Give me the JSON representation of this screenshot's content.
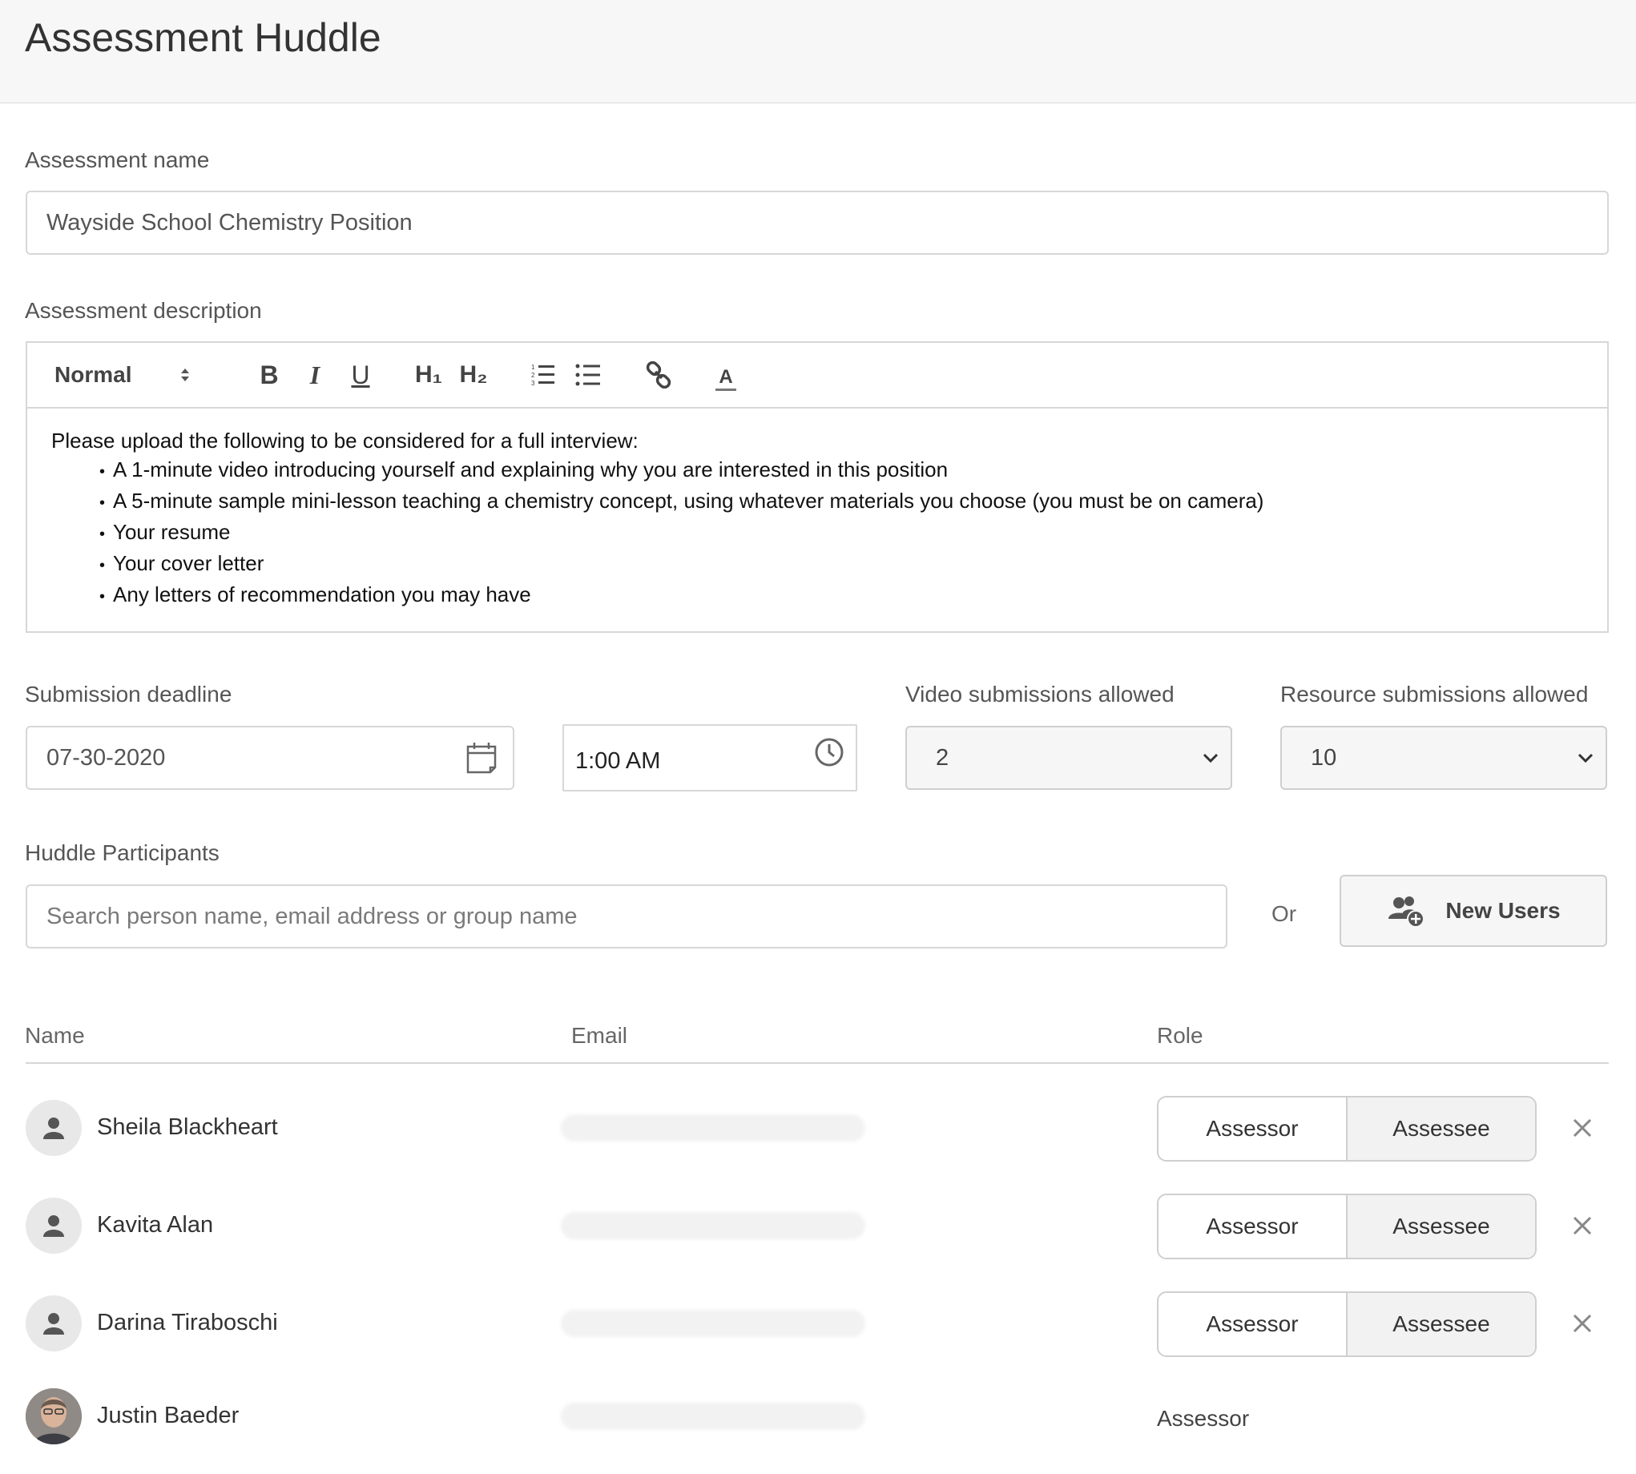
{
  "header": {
    "title": "Assessment Huddle"
  },
  "form": {
    "name_label": "Assessment name",
    "name_value": "Wayside School Chemistry Position",
    "description_label": "Assessment description",
    "toolbar": {
      "format": "Normal",
      "bold": "B",
      "italic": "I",
      "underline": "U",
      "h1": "H₁",
      "h2": "H₂",
      "color": "A"
    },
    "description": {
      "intro": "Please upload the following to be considered for a full interview:",
      "items": [
        "A 1-minute video introducing yourself and explaining why you are interested in this position",
        "A 5-minute sample mini-lesson teaching a chemistry concept, using whatever materials you choose (you must be on camera)",
        "Your resume",
        "Your cover letter",
        "Any letters of recommendation you may have"
      ]
    },
    "deadline_label": "Submission deadline",
    "deadline_date": "07-30-2020",
    "deadline_time": "1:00 AM",
    "video_label": "Video submissions allowed",
    "video_value": "2",
    "resource_label": "Resource submissions allowed",
    "resource_value": "10",
    "participants_label": "Huddle Participants",
    "search_placeholder": "Search person name, email address or group name",
    "or_text": "Or",
    "new_users_label": "New Users"
  },
  "table": {
    "headers": {
      "name": "Name",
      "email": "Email",
      "role": "Role"
    },
    "rows": [
      {
        "name": "Sheila Blackheart",
        "role_a": "Assessor",
        "role_b": "Assessee"
      },
      {
        "name": "Kavita Alan",
        "role_a": "Assessor",
        "role_b": "Assessee"
      },
      {
        "name": "Darina Tiraboschi",
        "role_a": "Assessor",
        "role_b": "Assessee"
      },
      {
        "name": "Justin Baeder",
        "role": "Assessor"
      }
    ]
  },
  "icons": {
    "calendar": "calendar-icon",
    "clock": "clock-icon",
    "chevron": "chevron-down-icon",
    "add_user": "add-users-icon",
    "person": "person-icon",
    "close": "close-icon"
  }
}
